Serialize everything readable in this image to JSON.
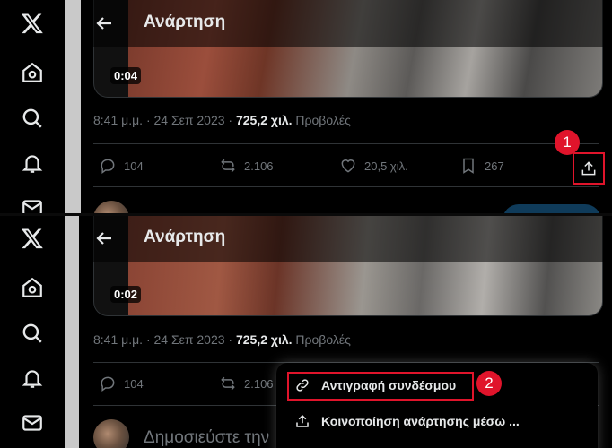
{
  "header": {
    "title": "Ανάρτηση"
  },
  "video": {
    "timecode_top": "0:04",
    "timecode_bottom": "0:02"
  },
  "post_meta": {
    "time": "8:41 μ.μ. · 24 Σεπ 2023 · ",
    "views": "725,2 χιλ.",
    "views_label": " Προβολές"
  },
  "actions": {
    "replies": "104",
    "reposts": "2.106",
    "likes": "20,5 χιλ.",
    "bookmarks": "267"
  },
  "annotations": {
    "step1": "1",
    "step2": "2"
  },
  "reply": {
    "placeholder": "Δημοσιεύστε την"
  },
  "share_menu": {
    "copy_link": "Αντιγραφή συνδέσμου",
    "share_via": "Κοινοποίηση ανάρτησης μέσω ..."
  },
  "colors": {
    "highlight": "#e0142b",
    "background": "#000000",
    "muted": "#71767b"
  }
}
